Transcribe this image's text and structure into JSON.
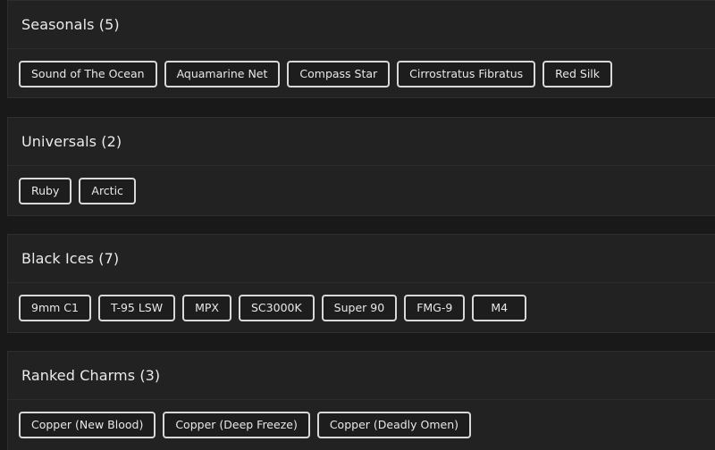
{
  "sections": [
    {
      "title": "Seasonals (5)",
      "items": [
        "Sound of The Ocean",
        "Aquamarine Net",
        "Compass Star",
        "Cirrostratus Fibratus",
        "Red Silk"
      ]
    },
    {
      "title": "Universals (2)",
      "items": [
        "Ruby",
        "Arctic"
      ]
    },
    {
      "title": "Black Ices (7)",
      "items": [
        "9mm C1",
        "T-95 LSW",
        "MPX",
        "SC3000K",
        "Super 90",
        "FMG-9",
        "M4"
      ]
    },
    {
      "title": "Ranked Charms (3)",
      "items": [
        "Copper (New Blood)",
        "Copper (Deep Freeze)",
        "Copper (Deadly Omen)"
      ]
    }
  ]
}
